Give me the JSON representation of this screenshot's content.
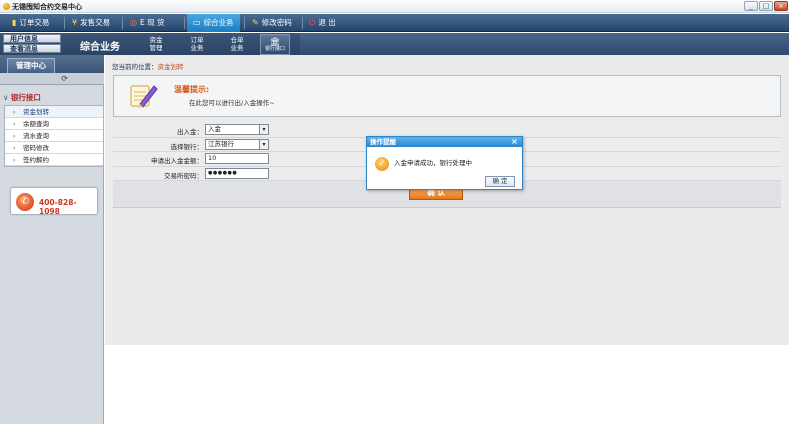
{
  "window": {
    "title": "无锡囤知合约交易中心",
    "controls": [
      "_",
      "□",
      "×"
    ]
  },
  "topnav": {
    "items": [
      {
        "icon": "bar-chart-icon",
        "glyph": "📊",
        "label": "订单交易"
      },
      {
        "icon": "yen-icon",
        "glyph": "¥",
        "label": "发售交易"
      },
      {
        "icon": "globe-icon",
        "glyph": "◎",
        "label": "E 现 货"
      },
      {
        "icon": "monitor-icon",
        "glyph": "▭",
        "label": "综合业务"
      },
      {
        "icon": "key-icon",
        "glyph": "✎",
        "label": "修改密码"
      },
      {
        "icon": "power-icon",
        "glyph": "⏻",
        "label": "退   出"
      }
    ]
  },
  "subnav": {
    "user_info": "用户信息",
    "view_messages": "查看消息",
    "title": "综合业务",
    "items": [
      {
        "line1": "资金",
        "line2": "管理"
      },
      {
        "line1": "订单",
        "line2": "业务"
      },
      {
        "line1": "仓单",
        "line2": "业务"
      },
      {
        "line1": "",
        "line2": "银行接口"
      }
    ]
  },
  "sidebar": {
    "tab": "管理中心",
    "group": "银行接口",
    "items": [
      "资金划转",
      "余额查询",
      "流水查询",
      "密码修改",
      "签约解约"
    ],
    "selected_index": 0,
    "phone": "400-828-1098"
  },
  "main": {
    "breadcrumb_prefix": "您当前的位置：",
    "breadcrumb_current": "资金划转",
    "tip_title": "温馨提示:",
    "tip_text": "在此您可以进行出/入金操作~",
    "form": {
      "direction_label": "出入金：",
      "direction_value": "入金",
      "bank_label": "选择银行：",
      "bank_value": "江苏银行",
      "amount_label": "申请出入金金额：",
      "amount_value": "10",
      "password_label": "交易所密码：",
      "password_value": "●●●●●●"
    },
    "confirm_label": "确 认"
  },
  "dialog": {
    "title": "操作提醒",
    "close": "×",
    "message": "入金申请成功，银行处理中",
    "ok_label": "确 定"
  },
  "colors": {
    "accent_orange": "#e4791b",
    "nav_dark": "#23456c",
    "nav_active": "#1c7cc0",
    "alert_red": "#b0262a"
  }
}
